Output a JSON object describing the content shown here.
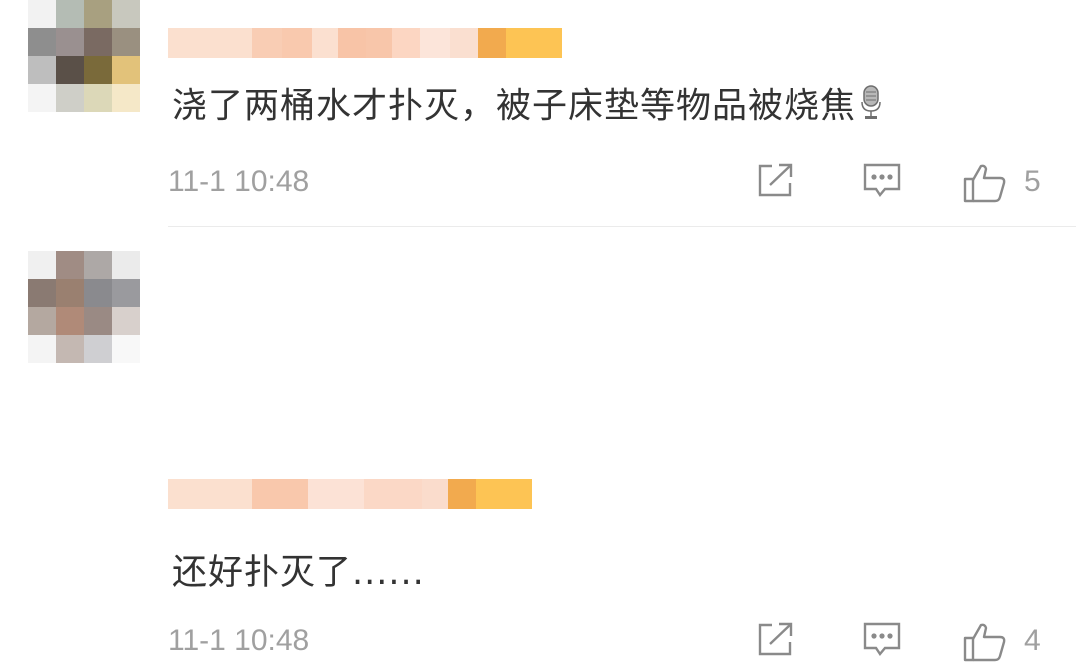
{
  "comments": [
    {
      "text": "浇了两桶水才扑灭，被子床垫等物品被烧焦",
      "emoji_icon": "microphone-emoji-icon",
      "time": "11-1 10:48",
      "likes": "5"
    },
    {
      "text": "还好扑灭了......",
      "time": "11-1 10:48",
      "likes": "4"
    }
  ],
  "colors": {
    "text": "#333333",
    "meta": "#a0a0a0",
    "divider": "#ebebeb"
  }
}
